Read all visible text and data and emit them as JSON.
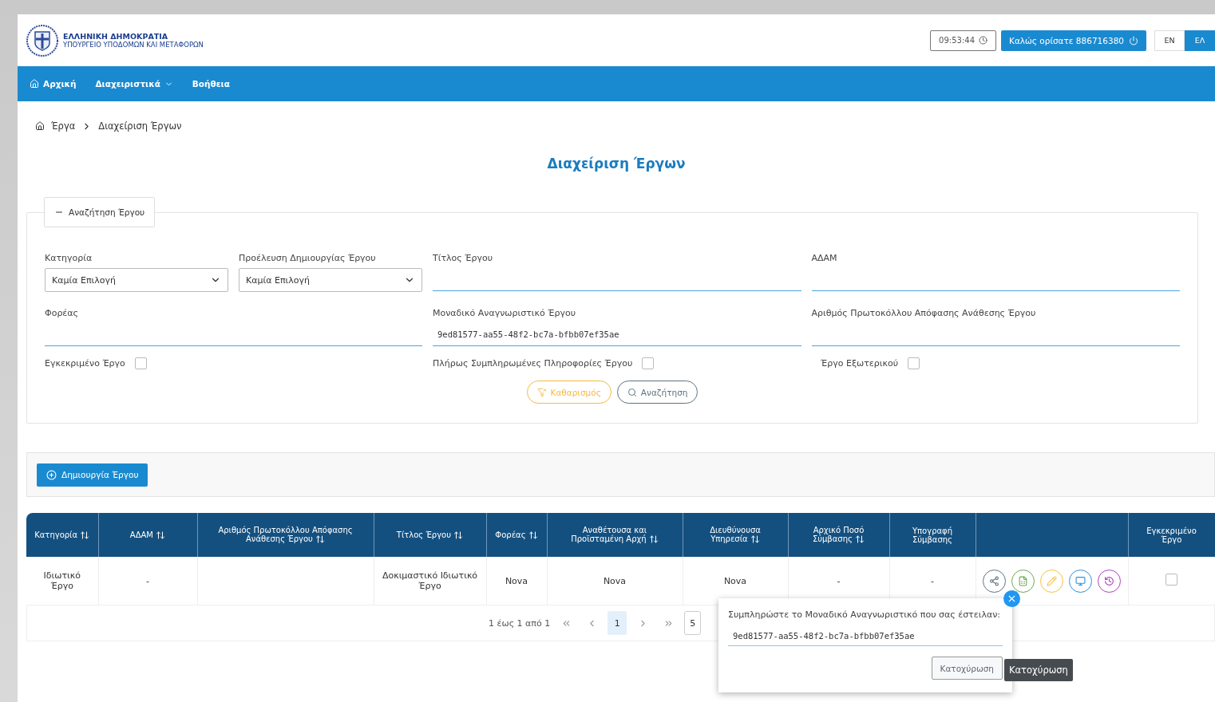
{
  "header": {
    "org_name": "ΕΛΛΗΝΙΚΗ ΔΗΜΟΚΡΑΤΙΑ",
    "ministry": "ΥΠΟΥΡΓΕΙΟ ΥΠΟΔΟΜΩΝ ΚΑΙ ΜΕΤΑΦΟΡΩΝ",
    "clock": "09:53:44",
    "welcome": "Καλώς ορίσατε 886716380",
    "languages": [
      {
        "label": "EN",
        "selected": false
      },
      {
        "label": "ΕΛ",
        "selected": true
      }
    ]
  },
  "nav": [
    {
      "label": "Αρχική",
      "kind": "home"
    },
    {
      "label": "Διαχειριστικά",
      "kind": "dropdown"
    },
    {
      "label": "Βοήθεια",
      "kind": "plain"
    }
  ],
  "breadcrumb": [
    "Έργα",
    "Διαχείριση Έργων"
  ],
  "page_title": "Διαχείριση Έργων",
  "search": {
    "legend": "Αναζήτηση Έργου",
    "expanded": true,
    "fields": [
      {
        "label": "Κατηγορία",
        "kind": "select",
        "value": "Καμία Επιλογή",
        "wide": false
      },
      {
        "label": "Προέλευση Δημιουργίας Έργου",
        "kind": "select",
        "value": "Καμία Επιλογή",
        "wide": false
      },
      {
        "label": "Τίτλος Έργου",
        "kind": "text",
        "wide": false
      },
      {
        "label": "ΑΔΑΜ",
        "kind": "text",
        "wide": false
      },
      {
        "label": "Φορέας",
        "kind": "text",
        "wide": true
      },
      {
        "label": "Μοναδικό Αναγνωριστικό Έργου",
        "kind": "text",
        "value": "9ed81577-aa55-48f2-bc7a-bfbb07ef35ae",
        "wide": false
      },
      {
        "label": "Αριθμός Πρωτοκόλλου Απόφασης Ανάθεσης Έργου",
        "kind": "text",
        "wide": false
      }
    ],
    "checkboxes": [
      {
        "label": "Εγκεκριμένο Έργο",
        "checked": false
      },
      {
        "label": "Πλήρως Συμπληρωμένες Πληροφορίες Έργου",
        "checked": false
      },
      {
        "label": "Έργο Εξωτερικού",
        "checked": false
      }
    ],
    "buttons": [
      {
        "label": "Καθαρισμός",
        "kind": "clear"
      },
      {
        "label": "Αναζήτηση",
        "kind": "search"
      }
    ]
  },
  "create_button": "Δημιουργία Έργου",
  "table": {
    "columns": [
      {
        "label": "Κατηγορία",
        "sortable": true
      },
      {
        "label": "ΑΔΑΜ",
        "sortable": true
      },
      {
        "label": "Αριθμός Πρωτοκόλλου Απόφασης Ανάθεσης Έργου",
        "sortable": true
      },
      {
        "label": "Τίτλος Έργου",
        "sortable": true
      },
      {
        "label": "Φορέας",
        "sortable": true
      },
      {
        "label": "Αναθέτουσα και Προϊσταμένη Αρχή",
        "sortable": true
      },
      {
        "label": "Διευθύνουσα Υπηρεσία",
        "sortable": true
      },
      {
        "label": "Αρχικό Ποσό Σύμβασης",
        "sortable": true
      },
      {
        "label": "Υπογραφή Σύμβασης",
        "sortable": false
      },
      {
        "sortable": false
      },
      {
        "label": "Εγκεκριμένο Έργο",
        "sortable": false
      }
    ],
    "rows": [
      {
        "cells": [
          "Ιδιωτικό Έργο",
          "-",
          null,
          "Δοκιμαστικό Ιδιωτικό Έργο",
          "Nova",
          "Nova",
          "Nova",
          "-",
          "-"
        ],
        "approved": false,
        "actions": [
          {
            "kind": "share",
            "color": "#5f7380"
          },
          {
            "kind": "excel",
            "color": "#6aa84f"
          },
          {
            "kind": "edit",
            "color": "#f5c242"
          },
          {
            "kind": "monitor",
            "color": "#2f8fd8"
          },
          {
            "kind": "history",
            "color": "#b03fc4"
          }
        ]
      }
    ],
    "pagination": {
      "summary": "1 έως 1 από 1",
      "pages": [
        {
          "label": "1",
          "selected": true
        }
      ],
      "page_size": "5"
    }
  },
  "popover": {
    "prompt": "Συμπληρώστε το Μοναδικό Αναγνωριστικό που σας έστειλαν:",
    "value": "9ed81577-aa55-48f2-bc7a-bfbb07ef35ae",
    "button": "Κατοχύρωση",
    "tooltip": "Κατοχύρωση"
  }
}
